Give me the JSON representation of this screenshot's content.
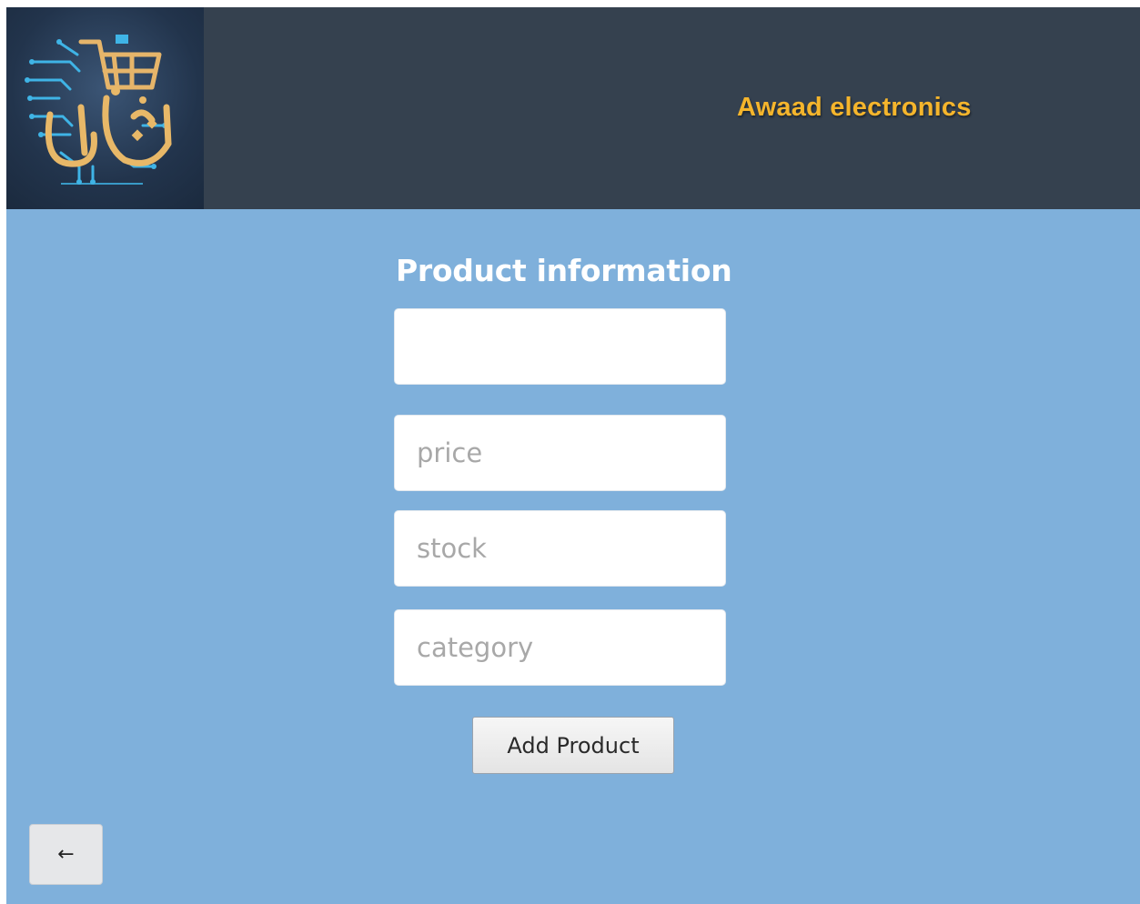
{
  "header": {
    "brand_name": "Awaad electronics",
    "logo_icon": "shopping-cart-circuit-logo-icon",
    "brand_color": "#f5b52c",
    "background_color": "#35414f"
  },
  "main": {
    "title": "Product information",
    "background_color": "#7fb0db",
    "fields": {
      "name": {
        "value": "",
        "placeholder": ""
      },
      "price": {
        "value": "",
        "placeholder": "price"
      },
      "stock": {
        "value": "",
        "placeholder": "stock"
      },
      "category": {
        "value": "",
        "placeholder": "category"
      }
    },
    "add_button_label": "Add Product"
  },
  "footer": {
    "back_button_label": "←",
    "back_icon": "arrow-left-icon"
  }
}
